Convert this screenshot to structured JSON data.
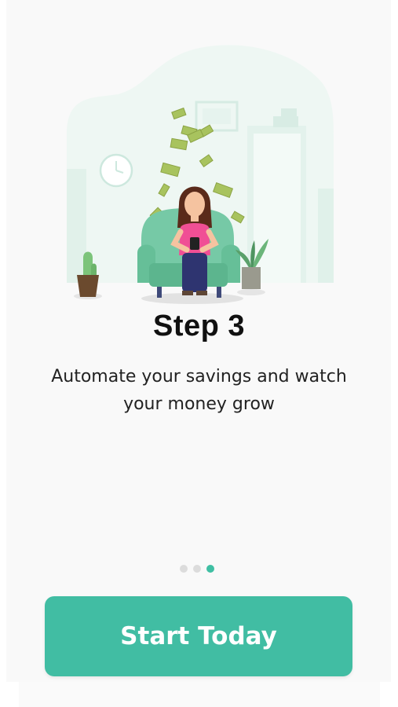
{
  "onboarding": {
    "step_title": "Step 3",
    "description": "Automate your savings and watch your money grow",
    "cta_label": "Start Today",
    "page_indicator": {
      "total": 3,
      "current": 3
    }
  },
  "colors": {
    "accent": "#41bda3",
    "dot_inactive": "#dcdcdc",
    "illustration_bg": "#eef7f3"
  },
  "illustration": {
    "subject": "woman-on-armchair-with-phone-and-falling-money"
  }
}
